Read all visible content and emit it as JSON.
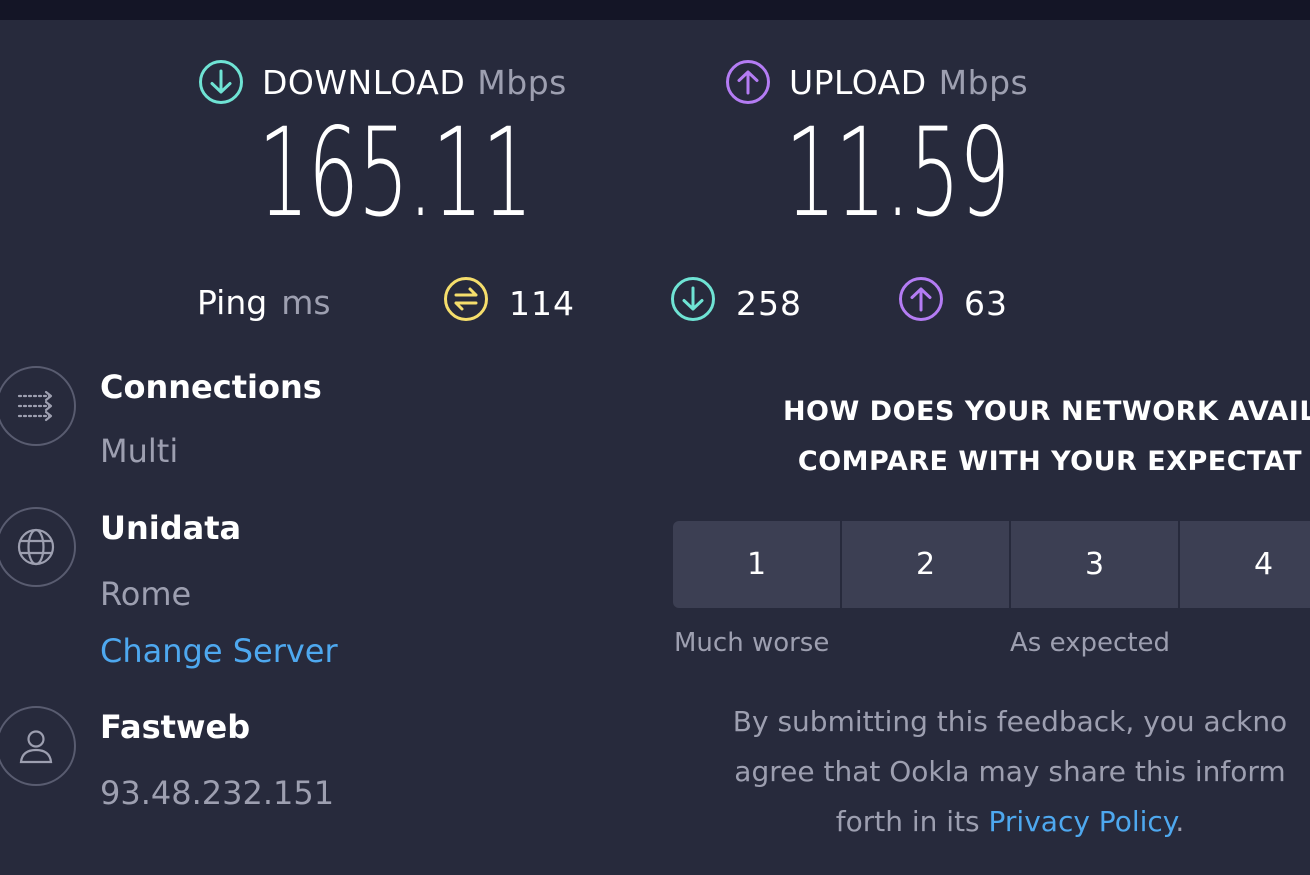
{
  "download": {
    "label": "DOWNLOAD",
    "unit": "Mbps",
    "value": "165.11",
    "icon": "download-arrow-icon",
    "color": "#6fe3d4"
  },
  "upload": {
    "label": "UPLOAD",
    "unit": "Mbps",
    "value": "11.59",
    "icon": "upload-arrow-icon",
    "color": "#b47cf4"
  },
  "ping": {
    "label": "Ping",
    "unit": "ms",
    "idle": {
      "value": "114",
      "icon": "ping-idle-icon",
      "color": "#f5de6c"
    },
    "download": {
      "value": "258",
      "icon": "download-arrow-icon",
      "color": "#6fe3d4"
    },
    "upload": {
      "value": "63",
      "icon": "upload-arrow-icon",
      "color": "#b47cf4"
    }
  },
  "connections": {
    "title": "Connections",
    "value": "Multi",
    "icon": "connections-icon"
  },
  "server": {
    "title": "Unidata",
    "location": "Rome",
    "change_label": "Change Server",
    "icon": "globe-icon"
  },
  "provider": {
    "title": "Fastweb",
    "ip": "93.48.232.151",
    "icon": "user-icon"
  },
  "feedback": {
    "question_line1": "HOW DOES YOUR NETWORK AVAIL",
    "question_line2": "COMPARE WITH YOUR EXPECTAT",
    "options": [
      "1",
      "2",
      "3",
      "4"
    ],
    "scale_low": "Much worse",
    "scale_mid": "As expected",
    "disclaimer_line1": "By submitting this feedback, you ackno",
    "disclaimer_line2": "agree that Ookla may share this inform",
    "disclaimer_line3_prefix": "forth in its ",
    "privacy_link": "Privacy Policy",
    "disclaimer_line3_suffix": "."
  },
  "colors": {
    "background": "#272a3c",
    "link": "#4ea8ef",
    "muted": "#9d9fb0",
    "button": "#3c3f53"
  }
}
